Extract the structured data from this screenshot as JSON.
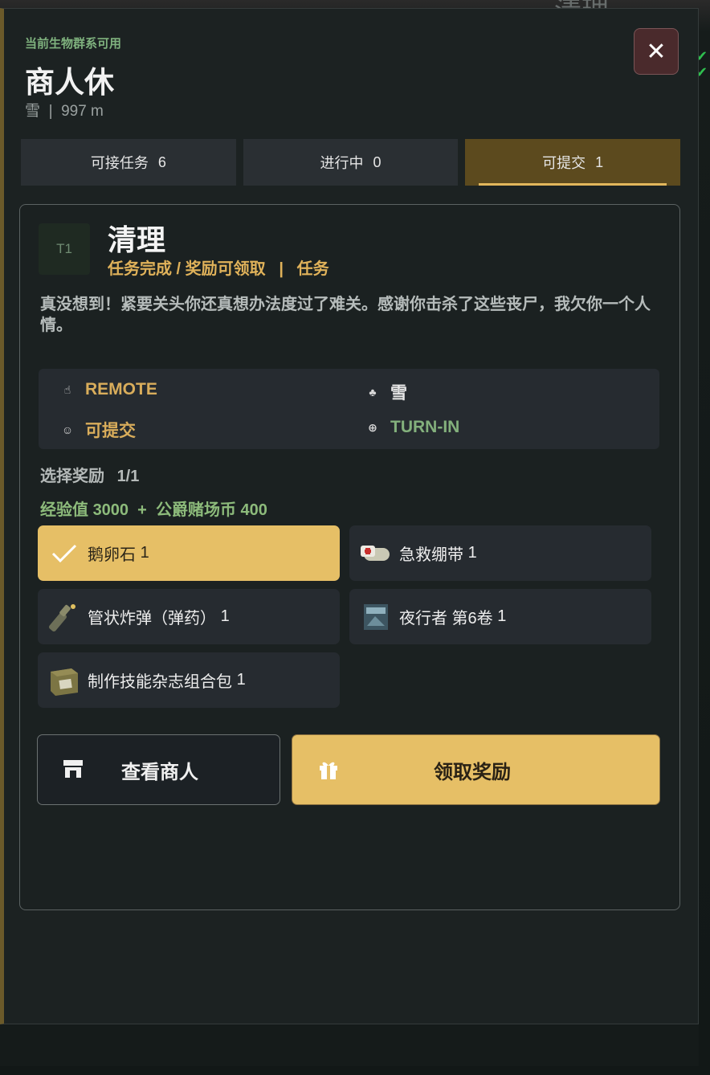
{
  "header": {
    "biome_note": "当前生物群系可用",
    "npc_name": "商人休",
    "location": "雪",
    "distance": "997 m",
    "close_glyph": "✕"
  },
  "tabs": [
    {
      "label": "可接任务",
      "count": "6",
      "active": false
    },
    {
      "label": "进行中",
      "count": "0",
      "active": false
    },
    {
      "label": "可提交",
      "count": "1",
      "active": true
    }
  ],
  "quest": {
    "tier": "T1",
    "title": "清理",
    "status": "任务完成 / 奖励可领取",
    "category": "任务",
    "description": "真没想到！紧要关头你还真想办法度过了难关。感谢你击杀了这些丧尸，我欠你一个人情。",
    "info": {
      "range": "REMOTE",
      "biome": "雪",
      "state": "可提交",
      "objective": "TURN-IN"
    }
  },
  "rewards": {
    "select_label": "选择奖励",
    "select_count": "1/1",
    "xp_label": "经验值",
    "xp_value": "3000",
    "currency_label": "公爵赌场币",
    "currency_value": "400",
    "items": [
      {
        "name": "鹅卵石",
        "qty": "1",
        "selected": true,
        "icon": "check-icon"
      },
      {
        "name": "急救绷带",
        "qty": "1",
        "selected": false,
        "icon": "bandage-icon"
      },
      {
        "name": "管状炸弹（弹药）",
        "qty": "1",
        "selected": false,
        "icon": "pipe-bomb-icon"
      },
      {
        "name": "夜行者 第6卷",
        "qty": "1",
        "selected": false,
        "icon": "magazine-icon"
      },
      {
        "name": "制作技能杂志组合包",
        "qty": "1",
        "selected": false,
        "icon": "crate-icon"
      }
    ]
  },
  "actions": {
    "merchant_label": "查看商人",
    "claim_label": "领取奖励"
  },
  "colors": {
    "accent_gold": "#e6bf66",
    "active_tab": "#5c4a1e",
    "status_gold": "#e0b25a",
    "positive_green": "#83b07c"
  }
}
